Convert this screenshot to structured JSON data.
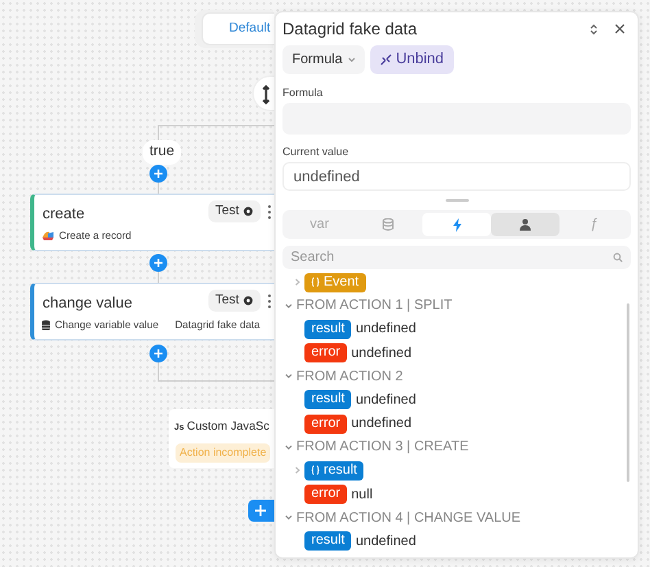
{
  "canvas": {
    "default_button": "Default",
    "branch_label": "true",
    "cards": [
      {
        "kind": "record",
        "title": "create",
        "test": "Test",
        "subtitle": "Create a record",
        "color": "#3fb68b"
      },
      {
        "kind": "variable",
        "title": "change value",
        "test": "Test",
        "subtitle": "Change variable value",
        "target": "Datagrid fake data",
        "color": "#2f8fd8"
      }
    ],
    "js_card": {
      "badge_text": "Js",
      "title": "Custom JavaSc",
      "status": "Action incomplete"
    }
  },
  "panel": {
    "title": "Datagrid fake data",
    "mode": "Formula",
    "unbind": "Unbind",
    "formula_label": "Formula",
    "current_label": "Current value",
    "current_value": "undefined",
    "tabs": [
      {
        "kind": "text",
        "label": "var",
        "selected": false,
        "hovered": false
      },
      {
        "kind": "database",
        "selected": false,
        "hovered": false
      },
      {
        "kind": "bolt",
        "selected": true,
        "hovered": false
      },
      {
        "kind": "person",
        "selected": false,
        "hovered": true
      },
      {
        "kind": "text",
        "label": "ƒ",
        "selected": false,
        "hovered": false
      }
    ],
    "search": {
      "placeholder": "Search"
    },
    "tree": [
      {
        "kind": "entry",
        "badge": "Event",
        "color": "#e09a10",
        "object": true,
        "expandable": true
      },
      {
        "kind": "group",
        "label": "FROM ACTION 1 | SPLIT",
        "expanded": true,
        "children": [
          {
            "kind": "entry",
            "badge": "result",
            "color": "#0b7fd4",
            "value": "undefined",
            "object": false,
            "expandable": false
          },
          {
            "kind": "entry",
            "badge": "error",
            "color": "#f4380f",
            "value": "undefined",
            "object": false,
            "expandable": false
          }
        ]
      },
      {
        "kind": "group",
        "label": "FROM ACTION 2",
        "expanded": true,
        "children": [
          {
            "kind": "entry",
            "badge": "result",
            "color": "#0b7fd4",
            "value": "undefined",
            "object": false,
            "expandable": false
          },
          {
            "kind": "entry",
            "badge": "error",
            "color": "#f4380f",
            "value": "undefined",
            "object": false,
            "expandable": false
          }
        ]
      },
      {
        "kind": "group",
        "label": "FROM ACTION 3 | CREATE",
        "expanded": true,
        "children": [
          {
            "kind": "entry",
            "badge": "result",
            "color": "#0b7fd4",
            "object": true,
            "expandable": true
          },
          {
            "kind": "entry",
            "badge": "error",
            "color": "#f4380f",
            "value": "null",
            "object": false,
            "expandable": false
          }
        ]
      },
      {
        "kind": "group",
        "label": "FROM ACTION 4 | CHANGE VALUE",
        "expanded": true,
        "children": [
          {
            "kind": "entry",
            "badge": "result",
            "color": "#0b7fd4",
            "value": "undefined",
            "object": false,
            "expandable": false
          }
        ]
      }
    ]
  }
}
